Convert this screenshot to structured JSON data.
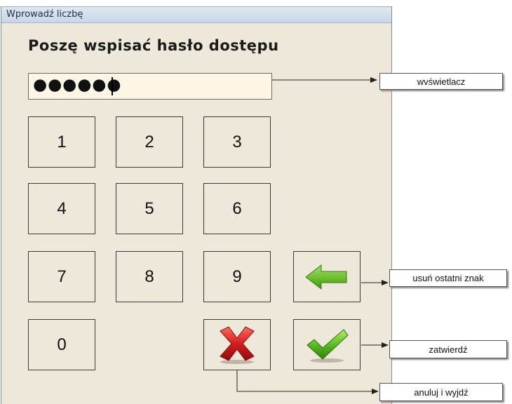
{
  "window": {
    "title": "Wprowadź liczbę"
  },
  "heading": "Poszę wspisać hasło dostępu",
  "display": {
    "value": "●●●●●●"
  },
  "keypad": {
    "keys": [
      "1",
      "2",
      "3",
      "4",
      "5",
      "6",
      "7",
      "8",
      "9",
      "0"
    ]
  },
  "actions": {
    "backspace_icon": "left-arrow-icon",
    "cancel_icon": "red-x-icon",
    "confirm_icon": "green-check-icon"
  },
  "callouts": {
    "display": "wvświetlacz",
    "backspace": "usuń ostatni znak",
    "confirm": "zatwierdź",
    "cancel": "anuluj i wyjdź"
  },
  "colors": {
    "window_bg": "#ede8d9",
    "display_bg": "#fdf6e6",
    "arrow_green": "#6cbe2e",
    "cross_red": "#d41e1e",
    "check_green": "#5cbf1f"
  }
}
